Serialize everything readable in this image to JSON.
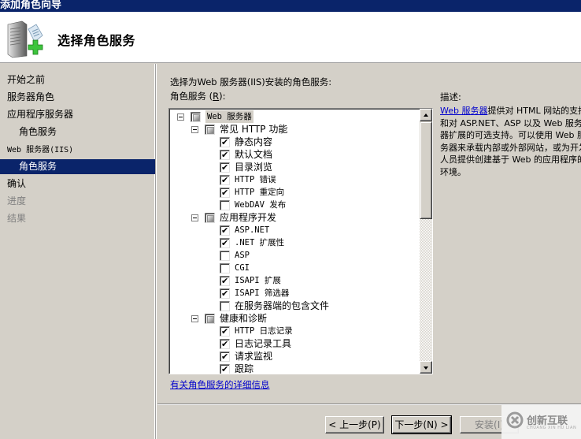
{
  "window": {
    "title": "添加角色向导"
  },
  "header": {
    "title": "选择角色服务",
    "icon": "server-add-icon"
  },
  "sidebar": {
    "items": [
      {
        "label": "开始之前",
        "level": 0,
        "state": "normal"
      },
      {
        "label": "服务器角色",
        "level": 0,
        "state": "normal"
      },
      {
        "label": "应用程序服务器",
        "level": 0,
        "state": "normal"
      },
      {
        "label": "角色服务",
        "level": 1,
        "state": "normal"
      },
      {
        "label": "Web 服务器(IIS)",
        "level": 0,
        "state": "normal"
      },
      {
        "label": "角色服务",
        "level": 1,
        "state": "active"
      },
      {
        "label": "确认",
        "level": 0,
        "state": "normal"
      },
      {
        "label": "进度",
        "level": 0,
        "state": "disabled"
      },
      {
        "label": "结果",
        "level": 0,
        "state": "disabled"
      }
    ]
  },
  "main": {
    "intro": "选择为Web 服务器(IIS)安装的角色服务:",
    "list_label_prefix": "角色服务 (",
    "list_label_key": "R",
    "list_label_suffix": "):",
    "tree": [
      {
        "label": "Web 服务器",
        "level": 0,
        "expander": true,
        "state": "partial",
        "selected": true
      },
      {
        "label": "常见 HTTP 功能",
        "level": 1,
        "expander": true,
        "state": "partial"
      },
      {
        "label": "静态内容",
        "level": 2,
        "state": "checked"
      },
      {
        "label": "默认文档",
        "level": 2,
        "state": "checked"
      },
      {
        "label": "目录浏览",
        "level": 2,
        "state": "checked"
      },
      {
        "label": "HTTP 错误",
        "level": 2,
        "state": "checked"
      },
      {
        "label": "HTTP 重定向",
        "level": 2,
        "state": "checked"
      },
      {
        "label": "WebDAV 发布",
        "level": 2,
        "state": "unchecked"
      },
      {
        "label": "应用程序开发",
        "level": 1,
        "expander": true,
        "state": "partial"
      },
      {
        "label": "ASP.NET",
        "level": 2,
        "state": "checked"
      },
      {
        "label": ".NET 扩展性",
        "level": 2,
        "state": "checked"
      },
      {
        "label": "ASP",
        "level": 2,
        "state": "unchecked"
      },
      {
        "label": "CGI",
        "level": 2,
        "state": "unchecked"
      },
      {
        "label": "ISAPI 扩展",
        "level": 2,
        "state": "checked"
      },
      {
        "label": "ISAPI 筛选器",
        "level": 2,
        "state": "checked"
      },
      {
        "label": "在服务器端的包含文件",
        "level": 2,
        "state": "unchecked"
      },
      {
        "label": "健康和诊断",
        "level": 1,
        "expander": true,
        "state": "partial"
      },
      {
        "label": "HTTP 日志记录",
        "level": 2,
        "state": "checked"
      },
      {
        "label": "日志记录工具",
        "level": 2,
        "state": "checked"
      },
      {
        "label": "请求监视",
        "level": 2,
        "state": "checked"
      },
      {
        "label": "跟踪",
        "level": 2,
        "state": "checked"
      }
    ],
    "more_info_link": "有关角色服务的详细信息",
    "description": {
      "label": "描述:",
      "link_text": "Web 服务器",
      "text": "提供对 HTML 网站的支持和对 ASP.NET、ASP 以及 Web 服务器扩展的可选支持。可以使用 Web 服务器来承载内部或外部网站，或为开发人员提供创建基于 Web 的应用程序的环境。"
    }
  },
  "footer": {
    "back_button": "< 上一步(P)",
    "next_button": "下一步(N) >",
    "install_button": "安装(I)"
  },
  "watermark": {
    "text": "创新互联",
    "subtext": "CHUANG XIN HU LIAN"
  }
}
